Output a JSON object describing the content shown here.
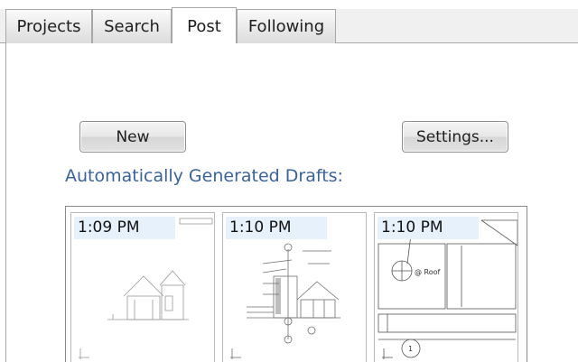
{
  "tabs": [
    {
      "label": "Projects",
      "active": false
    },
    {
      "label": "Search",
      "active": false
    },
    {
      "label": "Post",
      "active": true
    },
    {
      "label": "Following",
      "active": false
    }
  ],
  "buttons": {
    "new_label": "New",
    "settings_label": "Settings..."
  },
  "drafts": {
    "heading": "Automatically Generated Drafts:",
    "items": [
      {
        "time": "1:09 PM"
      },
      {
        "time": "1:10 PM"
      },
      {
        "time": "1:10 PM"
      }
    ]
  },
  "drawing_labels": {
    "section_mark": "@ Roof",
    "detail_number": "1"
  },
  "colors": {
    "heading": "#3a639c",
    "timestamp_bg": "#e7f1fb"
  }
}
